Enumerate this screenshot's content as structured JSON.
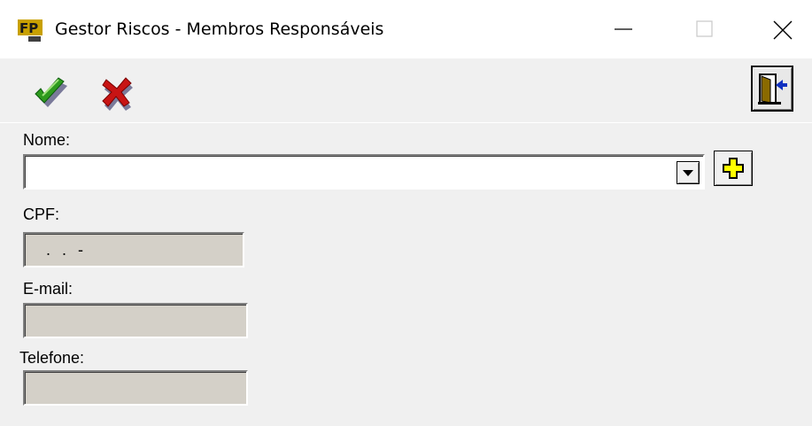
{
  "window": {
    "title": "Gestor Riscos - Membros Responsáveis",
    "controls": [
      "minimize",
      "maximize",
      "close"
    ]
  },
  "toolbar": {
    "items": [
      {
        "name": "confirm",
        "icon": "checkmark-icon",
        "color": "#2e9a1e"
      },
      {
        "name": "cancel",
        "icon": "x-icon",
        "color": "#c81414"
      },
      {
        "name": "exit",
        "icon": "exit-door-icon"
      }
    ]
  },
  "form": {
    "nome": {
      "label": "Nome:",
      "value": ""
    },
    "cpf": {
      "label": "CPF:",
      "mask": " .  .  -"
    },
    "email": {
      "label": "E-mail:",
      "value": ""
    },
    "telefone": {
      "label": "Telefone:",
      "value": ""
    }
  },
  "colors": {
    "window_bg": "#f0f0f0",
    "titlebar_bg": "#ffffff",
    "disabled_field_bg": "#d4d0c8",
    "add_icon": "#ffff00"
  }
}
